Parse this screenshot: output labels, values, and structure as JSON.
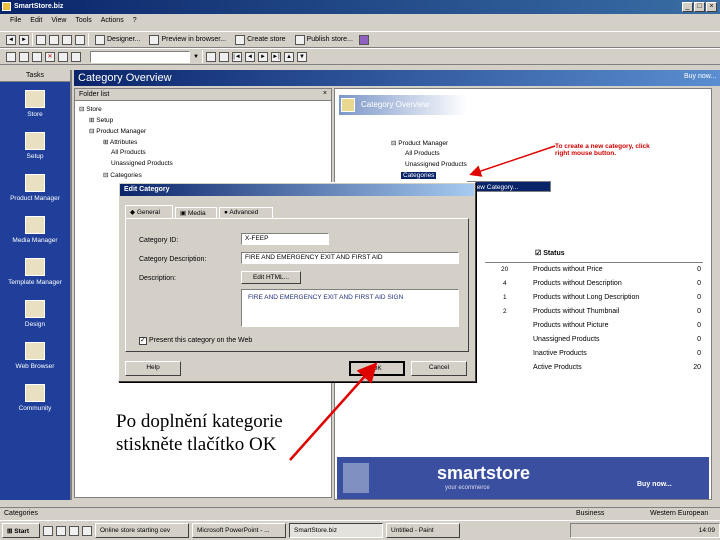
{
  "window": {
    "title": "SmartStore.biz"
  },
  "menu": [
    "File",
    "Edit",
    "View",
    "Tools",
    "Actions",
    "?"
  ],
  "toolbar1": [
    {
      "label": "Designer..."
    },
    {
      "label": "Preview in browser..."
    },
    {
      "label": "Create store"
    },
    {
      "label": "Publish store..."
    }
  ],
  "tasks": {
    "header": "Tasks",
    "items": [
      {
        "label": "Store"
      },
      {
        "label": "Setup"
      },
      {
        "label": "Product Manager"
      },
      {
        "label": "Media Manager"
      },
      {
        "label": "Template Manager"
      },
      {
        "label": "Design"
      },
      {
        "label": "Web Browser"
      },
      {
        "label": "Community"
      }
    ]
  },
  "page_title": "Category Overview",
  "folder": {
    "header": "Folder list",
    "close": "×",
    "tree": [
      "Store",
      "Setup",
      "Product Manager",
      "Attributes",
      "All Products",
      "Unassigned Products",
      "Categories"
    ]
  },
  "right": {
    "header": "Category Overview",
    "tree": [
      "Product Manager",
      "All Products",
      "Unassigned Products",
      "Categories"
    ],
    "hint": "To create a new category, click right mouse button.",
    "context_menu": "New Category...",
    "status_title": "Status",
    "left_counts": [
      "20",
      "4",
      "1",
      "2"
    ],
    "status": [
      {
        "label": "Products without Price",
        "value": "0"
      },
      {
        "label": "Products without Description",
        "value": "0"
      },
      {
        "label": "Products without Long Description",
        "value": "0"
      },
      {
        "label": "Products without Thumbnail",
        "value": "0"
      },
      {
        "label": "Products without Picture",
        "value": "0"
      },
      {
        "label": "Unassigned Products",
        "value": "0"
      },
      {
        "label": "Inactive Products",
        "value": "0"
      },
      {
        "label": "Active Products",
        "value": "20"
      }
    ]
  },
  "dialog": {
    "title": "Edit Category",
    "tabs": [
      "General",
      "Media",
      "Advanced"
    ],
    "category_id_label": "Category ID:",
    "category_id": "X-FEEP",
    "category_description_label": "Category Description:",
    "category_description": "FIRE AND EMERGENCY EXIT AND FIRST AID",
    "description_label": "Description:",
    "edit_html": "Edit HTML...",
    "description_text": "FIRE AND EMERGENCY EXIT AND FIRST AID SIGN",
    "present_label": "Present this category on the Web",
    "help": "Help",
    "ok": "OK",
    "cancel": "Cancel"
  },
  "banner": {
    "logo": "smartstore",
    "tagline": "your ecommerce",
    "buy": "Buy now..."
  },
  "annotation": "Po doplnění kategorie stiskněte tlačítko OK",
  "statusbar": {
    "left": "Categories",
    "business": "Business",
    "region": "Western European"
  },
  "taskbar": {
    "start": "Start",
    "items": [
      "Online store starting cev",
      "Microsoft PowerPoint - ...",
      "SmartStore.biz",
      "Untitled - Paint"
    ],
    "clock": "14:09"
  },
  "colors": {
    "accent": "#0a246a",
    "task_bg": "#1f3f9a",
    "arrow": "#e00000"
  }
}
